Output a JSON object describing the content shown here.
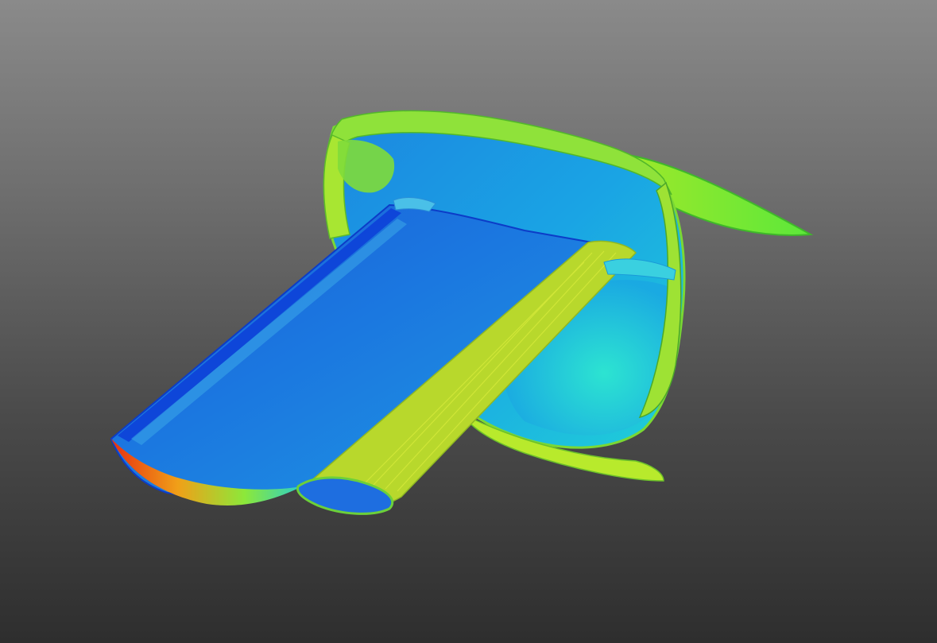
{
  "viewport": {
    "background_top": "#8a8a8a",
    "background_bottom": "#2e2e2e"
  },
  "scene": {
    "subject": "cfd-surface-render",
    "colormap": [
      "#0b2fd6",
      "#1a6fe0",
      "#19b2e6",
      "#22e0c8",
      "#7fe83a",
      "#c8f018",
      "#f0c018",
      "#e83010"
    ]
  }
}
